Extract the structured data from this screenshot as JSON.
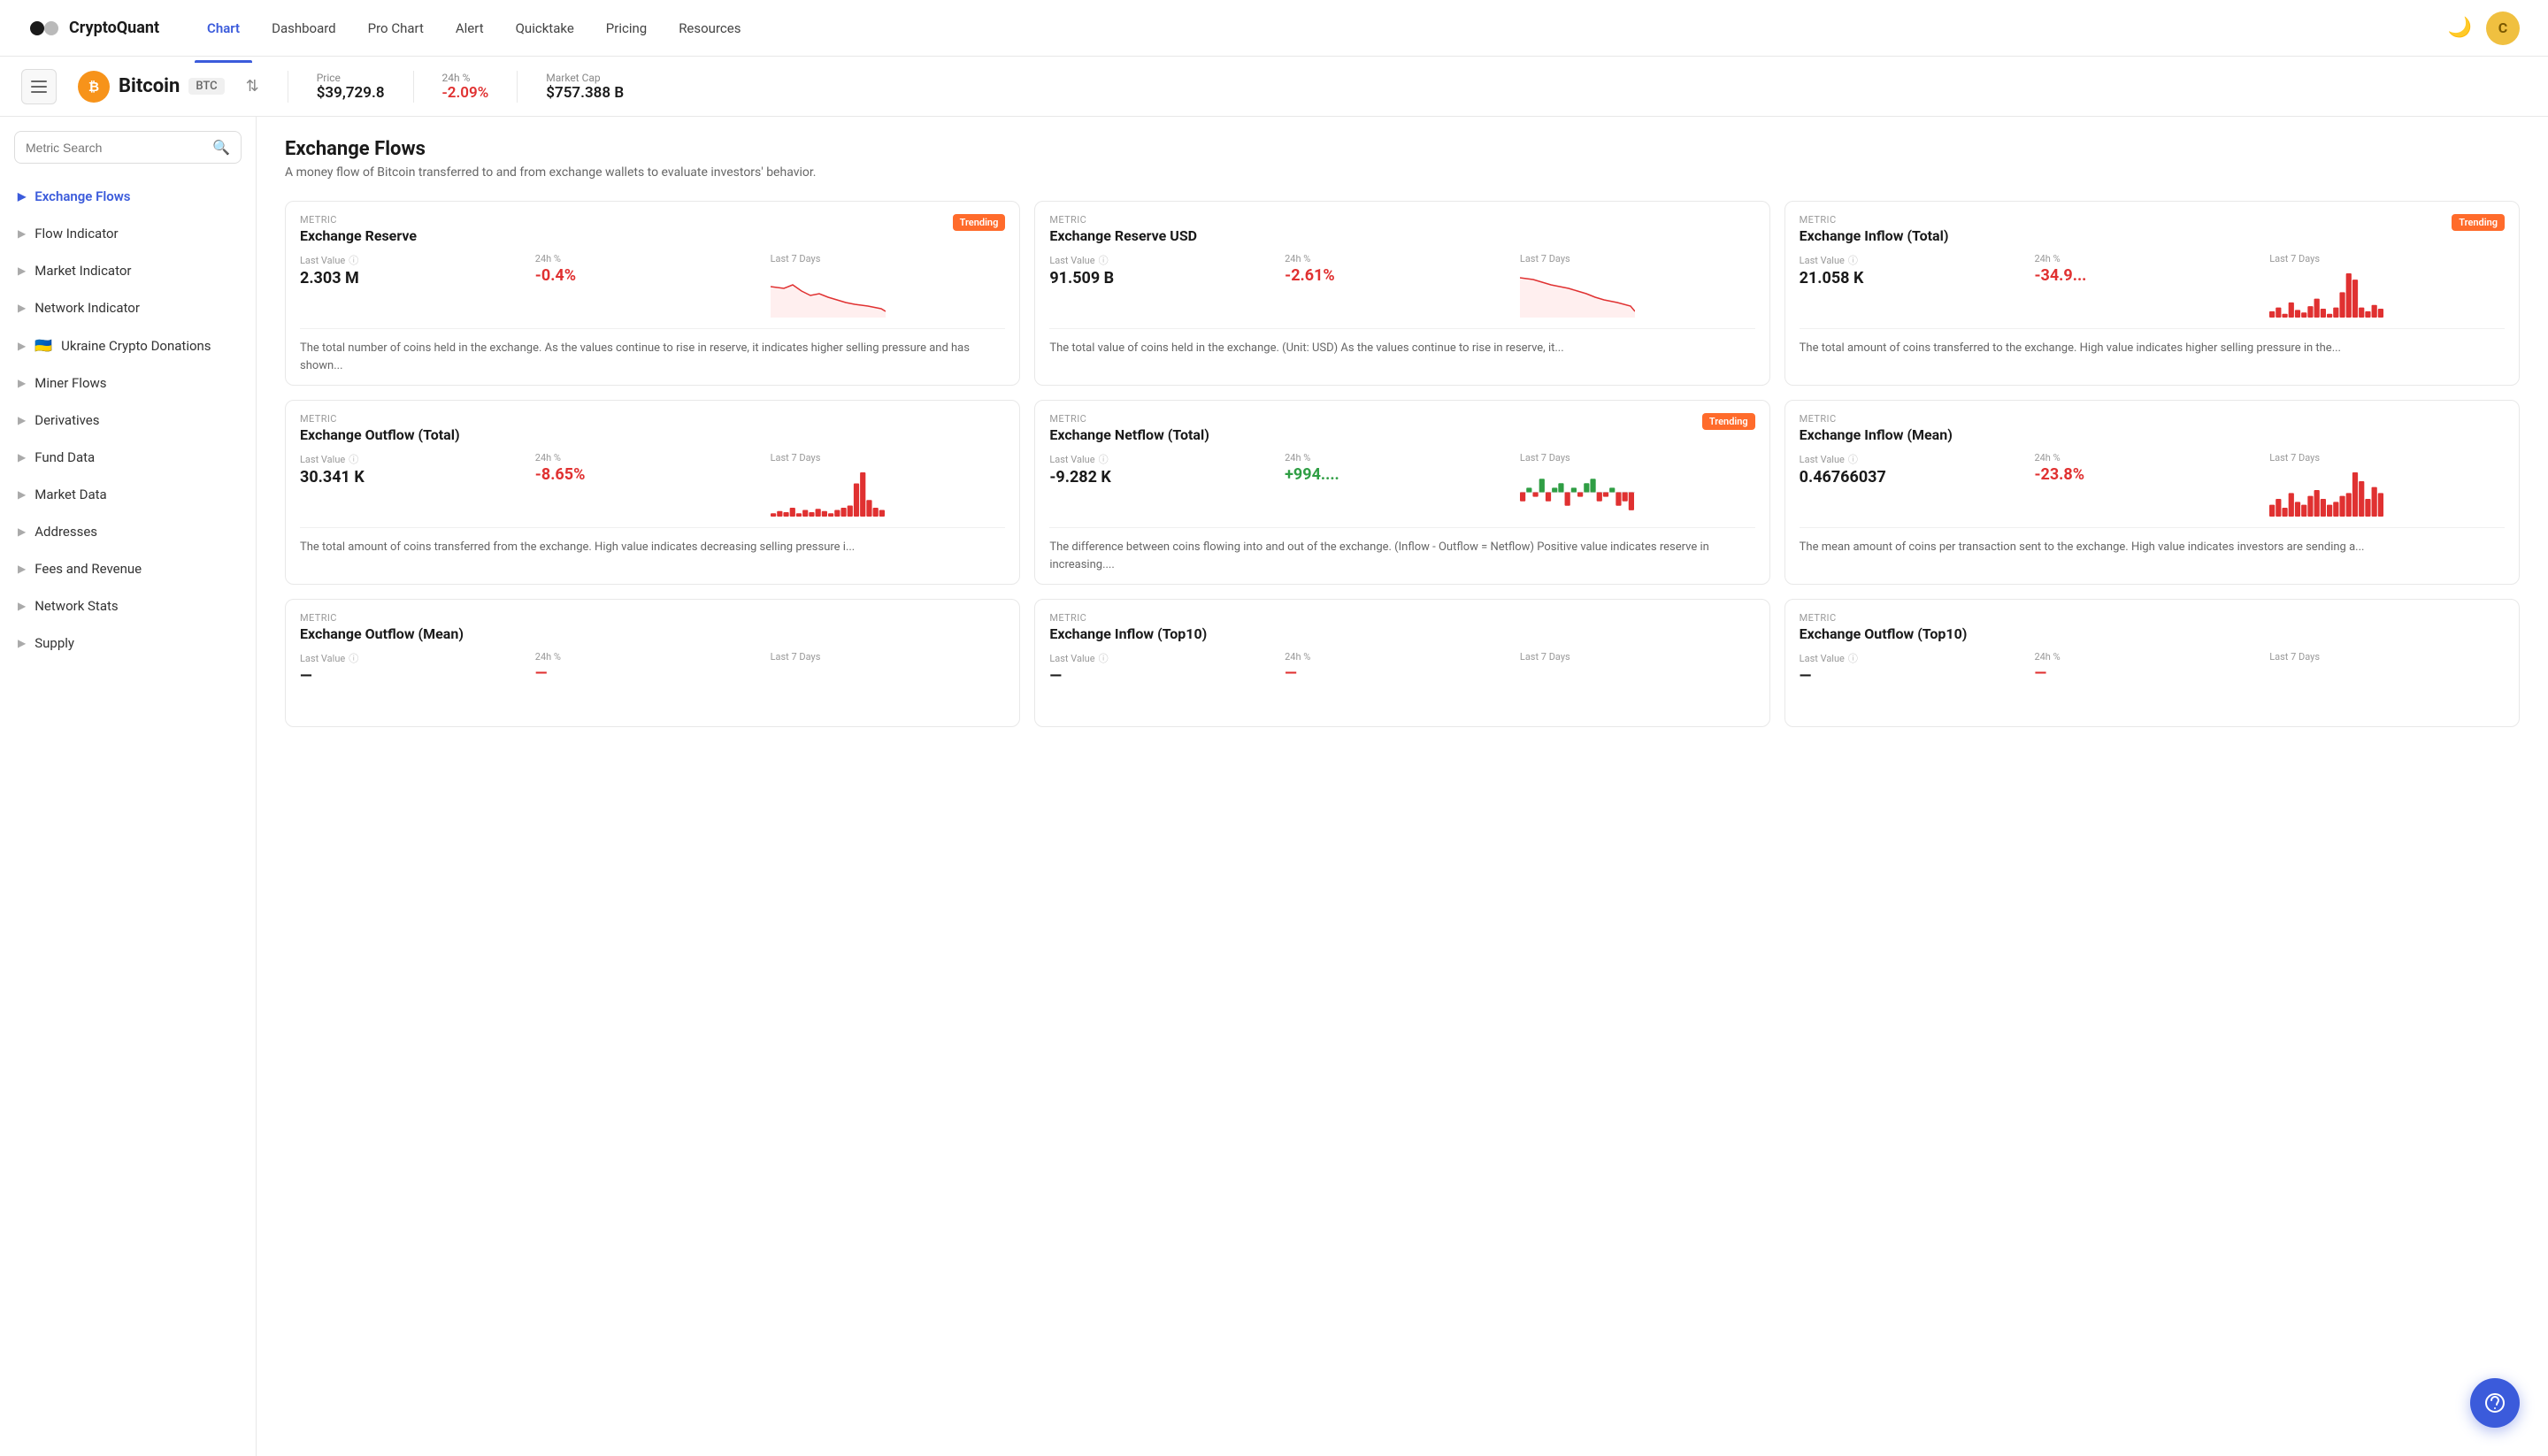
{
  "header": {
    "logo_text": "CryptoQuant",
    "nav_items": [
      {
        "label": "Chart",
        "active": true
      },
      {
        "label": "Dashboard",
        "active": false
      },
      {
        "label": "Pro Chart",
        "active": false
      },
      {
        "label": "Alert",
        "active": false
      },
      {
        "label": "Quicktake",
        "active": false
      },
      {
        "label": "Pricing",
        "active": false
      },
      {
        "label": "Resources",
        "active": false
      }
    ],
    "avatar_initial": "C"
  },
  "ticker": {
    "coin_name": "Bitcoin",
    "coin_symbol": "BTC",
    "price_label": "Price",
    "price_value": "$39,729.8",
    "change_label": "24h %",
    "change_value": "-2.09%",
    "marketcap_label": "Market Cap",
    "marketcap_value": "$757.388 B"
  },
  "search": {
    "placeholder": "Metric Search"
  },
  "sidebar": {
    "items": [
      {
        "label": "Exchange Flows",
        "active": true,
        "flag": ""
      },
      {
        "label": "Flow Indicator",
        "active": false,
        "flag": ""
      },
      {
        "label": "Market Indicator",
        "active": false,
        "flag": ""
      },
      {
        "label": "Network Indicator",
        "active": false,
        "flag": ""
      },
      {
        "label": "Ukraine Crypto Donations",
        "active": false,
        "flag": "🇺🇦"
      },
      {
        "label": "Miner Flows",
        "active": false,
        "flag": ""
      },
      {
        "label": "Derivatives",
        "active": false,
        "flag": ""
      },
      {
        "label": "Fund Data",
        "active": false,
        "flag": ""
      },
      {
        "label": "Market Data",
        "active": false,
        "flag": ""
      },
      {
        "label": "Addresses",
        "active": false,
        "flag": ""
      },
      {
        "label": "Fees and Revenue",
        "active": false,
        "flag": ""
      },
      {
        "label": "Network Stats",
        "active": false,
        "flag": ""
      },
      {
        "label": "Supply",
        "active": false,
        "flag": ""
      }
    ]
  },
  "section": {
    "title": "Exchange Flows",
    "description": "A money flow of Bitcoin transferred to and from exchange wallets to evaluate investors' behavior."
  },
  "metrics": [
    {
      "label": "Metric",
      "name": "Exchange Reserve",
      "trending": true,
      "last_value_label": "Last Value",
      "last_value": "2.303 M",
      "change_label": "24h %",
      "change_value": "-0.4%",
      "change_positive": false,
      "chart_label": "Last 7 Days",
      "description": "The total number of coins held in the exchange. As the values continue to rise in reserve, it indicates higher selling pressure and has shown...",
      "sparkline": "down"
    },
    {
      "label": "Metric",
      "name": "Exchange Reserve USD",
      "trending": false,
      "last_value_label": "Last Value",
      "last_value": "91.509 B",
      "change_label": "24h %",
      "change_value": "-2.61%",
      "change_positive": false,
      "chart_label": "Last 7 Days",
      "description": "The total value of coins held in the exchange. (Unit: USD) As the values continue to rise in reserve, it...",
      "sparkline": "down2"
    },
    {
      "label": "Metric",
      "name": "Exchange Inflow (Total)",
      "trending": true,
      "last_value_label": "Last Value",
      "last_value": "21.058 K",
      "change_label": "24h %",
      "change_value": "-34.9...",
      "change_positive": false,
      "chart_label": "Last 7 Days",
      "description": "The total amount of coins transferred to the exchange. High value indicates higher selling pressure in the...",
      "sparkline": "spiky"
    },
    {
      "label": "Metric",
      "name": "Exchange Outflow (Total)",
      "trending": false,
      "last_value_label": "Last Value",
      "last_value": "30.341 K",
      "change_label": "24h %",
      "change_value": "-8.65%",
      "change_positive": false,
      "chart_label": "Last 7 Days",
      "description": "The total amount of coins transferred from the exchange. High value indicates decreasing selling pressure i...",
      "sparkline": "spiky2"
    },
    {
      "label": "Metric",
      "name": "Exchange Netflow (Total)",
      "trending": true,
      "last_value_label": "Last Value",
      "last_value": "-9.282 K",
      "change_label": "24h %",
      "change_value": "+994....",
      "change_positive": true,
      "chart_label": "Last 7 Days",
      "description": "The difference between coins flowing into and out of the exchange. (Inflow - Outflow = Netflow) Positive value indicates reserve in increasing....",
      "sparkline": "netflow"
    },
    {
      "label": "Metric",
      "name": "Exchange Inflow (Mean)",
      "trending": false,
      "last_value_label": "Last Value",
      "last_value": "0.46766037",
      "change_label": "24h %",
      "change_value": "-23.8%",
      "change_positive": false,
      "chart_label": "Last 7 Days",
      "description": "The mean amount of coins per transaction sent to the exchange. High value indicates investors are sending a...",
      "sparkline": "spiky3"
    },
    {
      "label": "Metric",
      "name": "Exchange Outflow (Mean)",
      "trending": false,
      "last_value_label": "Last Value",
      "last_value": "—",
      "change_label": "24h %",
      "change_value": "—",
      "change_positive": false,
      "chart_label": "Last 7 Days",
      "description": "",
      "sparkline": "flat"
    },
    {
      "label": "Metric",
      "name": "Exchange Inflow (Top10)",
      "trending": false,
      "last_value_label": "Last Value",
      "last_value": "—",
      "change_label": "24h %",
      "change_value": "—",
      "change_positive": false,
      "chart_label": "Last 7 Days",
      "description": "",
      "sparkline": "flat"
    },
    {
      "label": "Metric",
      "name": "Exchange Outflow (Top10)",
      "trending": false,
      "last_value_label": "Last Value",
      "last_value": "—",
      "change_label": "24h %",
      "change_value": "—",
      "change_positive": false,
      "chart_label": "Last 7 Days",
      "description": "",
      "sparkline": "flat"
    }
  ]
}
